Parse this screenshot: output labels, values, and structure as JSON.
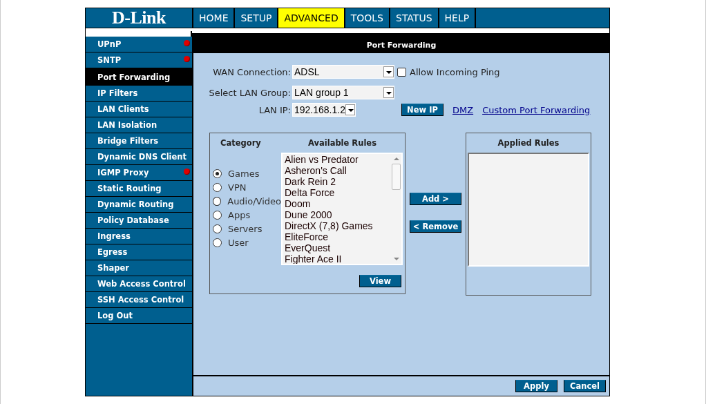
{
  "logo": "D-Link",
  "nav": [
    {
      "label": "HOME",
      "selected": false
    },
    {
      "label": "SETUP",
      "selected": false
    },
    {
      "label": "ADVANCED",
      "selected": true
    },
    {
      "label": "TOOLS",
      "selected": false
    },
    {
      "label": "STATUS",
      "selected": false
    },
    {
      "label": "HELP",
      "selected": false
    }
  ],
  "sidebar": {
    "items": [
      {
        "label": "UPnP",
        "selected": false,
        "alert": true
      },
      {
        "label": "SNTP",
        "selected": false,
        "alert": true
      },
      {
        "label": "Port Forwarding",
        "selected": true,
        "alert": false
      },
      {
        "label": "IP Filters",
        "selected": false,
        "alert": false
      },
      {
        "label": "LAN Clients",
        "selected": false,
        "alert": false
      },
      {
        "label": "LAN Isolation",
        "selected": false,
        "alert": false
      },
      {
        "label": "Bridge Filters",
        "selected": false,
        "alert": false
      },
      {
        "label": "Dynamic DNS Client",
        "selected": false,
        "alert": false
      },
      {
        "label": "IGMP Proxy",
        "selected": false,
        "alert": true
      },
      {
        "label": "Static Routing",
        "selected": false,
        "alert": false
      },
      {
        "label": "Dynamic Routing",
        "selected": false,
        "alert": false
      },
      {
        "label": "Policy Database",
        "selected": false,
        "alert": false
      },
      {
        "label": "Ingress",
        "selected": false,
        "alert": false
      },
      {
        "label": "Egress",
        "selected": false,
        "alert": false
      },
      {
        "label": "Shaper",
        "selected": false,
        "alert": false
      },
      {
        "label": "Web Access Control",
        "selected": false,
        "alert": false
      },
      {
        "label": "SSH Access Control",
        "selected": false,
        "alert": false
      },
      {
        "label": "Log Out",
        "selected": false,
        "alert": false
      }
    ]
  },
  "title": "Port Forwarding",
  "wan_connection": {
    "label": "WAN Connection:",
    "value": "ADSL"
  },
  "allow_ping": {
    "label": "Allow Incoming Ping",
    "checked": false
  },
  "lan_group": {
    "label": "Select LAN Group:",
    "value": "LAN group 1"
  },
  "lan_ip": {
    "label": "LAN IP:",
    "value": "192.168.1.2"
  },
  "new_ip_button": "New IP",
  "links": [
    "DMZ",
    "Custom Port Forwarding"
  ],
  "category": {
    "heading": "Category",
    "options": [
      {
        "label": "Games",
        "selected": true
      },
      {
        "label": "VPN",
        "selected": false
      },
      {
        "label": "Audio/Video",
        "selected": false
      },
      {
        "label": "Apps",
        "selected": false
      },
      {
        "label": "Servers",
        "selected": false
      },
      {
        "label": "User",
        "selected": false
      }
    ]
  },
  "available_rules": {
    "heading": "Available Rules",
    "items": [
      "Alien vs Predator",
      "Asheron's Call",
      "Dark Rein 2",
      "Delta Force",
      "Doom",
      "Dune 2000",
      "DirectX (7,8) Games",
      "EliteForce",
      "EverQuest",
      "Fighter Ace II"
    ]
  },
  "view_button": "View",
  "add_button": "Add >",
  "remove_button": "< Remove",
  "applied_rules": {
    "heading": "Applied Rules"
  },
  "footer_buttons": [
    "Apply",
    "Cancel"
  ]
}
